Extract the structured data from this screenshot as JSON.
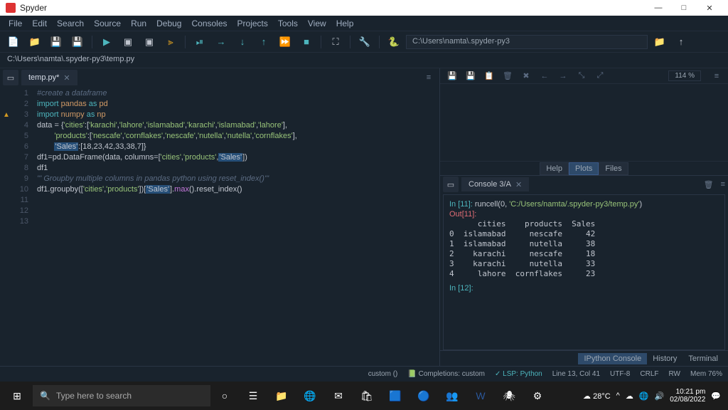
{
  "window": {
    "title": "Spyder",
    "min": "—",
    "max": "□",
    "close": "✕"
  },
  "menu": [
    "File",
    "Edit",
    "Search",
    "Source",
    "Run",
    "Debug",
    "Consoles",
    "Projects",
    "Tools",
    "View",
    "Help"
  ],
  "pathcombo": "C:\\Users\\namta\\.spyder-py3",
  "breadcrumb": "C:\\Users\\namta\\.spyder-py3\\temp.py",
  "editor": {
    "tab": "temp.py*",
    "linecount": 13,
    "lines": [
      {
        "n": 1,
        "html": "<span class='c-com'>#create a dataframe</span>"
      },
      {
        "n": 2,
        "html": "<span class='c-kw'>import</span> <span class='c-mod'>pandas</span> <span class='c-kw'>as</span> <span class='c-mod'>pd</span>"
      },
      {
        "n": 3,
        "html": "<span class='c-kw'>import</span> <span class='c-mod'>numpy</span> <span class='c-kw'>as</span> <span class='c-mod'>np</span>"
      },
      {
        "n": 4,
        "html": ""
      },
      {
        "n": 5,
        "html": "data = {<span class='c-str'>'cities'</span>:[<span class='c-str'>'karachi'</span>,<span class='c-str'>'lahore'</span>,<span class='c-str'>'islamabad'</span>,<span class='c-str'>'karachi'</span>,<span class='c-str'>'islamabad'</span>,<span class='c-str'>'lahore'</span>],"
      },
      {
        "n": 6,
        "html": "        <span class='c-str'>'products'</span>:[<span class='c-str'>'nescafe'</span>,<span class='c-str'>'cornflakes'</span>,<span class='c-str'>'nescafe'</span>,<span class='c-str'>'nutella'</span>,<span class='c-str'>'nutella'</span>,<span class='c-str'>'cornflakes'</span>],"
      },
      {
        "n": 7,
        "html": "        <span class='c-hl'>'Sales'</span>:[18,23,42,33,38,7]}"
      },
      {
        "n": 8,
        "html": ""
      },
      {
        "n": 9,
        "html": "df1=pd.DataFrame(data, columns=[<span class='c-str'>'cities'</span>,<span class='c-str'>'products'</span>,<span class='c-hl'>'Sales'</span>])"
      },
      {
        "n": 10,
        "html": "df1"
      },
      {
        "n": 11,
        "html": "<span class='c-com'>''' Groupby multiple columns in pandas python using reset_index()'''</span>"
      },
      {
        "n": 12,
        "html": ""
      },
      {
        "n": 13,
        "html": "df1.groupby([<span class='c-str'>'cities'</span>,<span class='c-str'>'products'</span>])[<span class='c-hl'>'Sales'</span>].<span class='c-fn'>max</span>().reset_index()"
      }
    ],
    "hlrow": 13
  },
  "plots": {
    "zoom": "114 %",
    "tabs": [
      "Help",
      "Plots",
      "Files"
    ],
    "active": 1
  },
  "console": {
    "tab": "Console 3/A",
    "in_prompt": "In [11]:",
    "in_cmd_pre": "runcell(0, ",
    "in_cmd_str": "'C:/Users/namta/.spyder-py3/temp.py'",
    "in_cmd_post": ")",
    "out_prompt": "Out[11]:",
    "table_hdr": "      cities    products  Sales",
    "table_rows": [
      "0  islamabad     nescafe     42",
      "1  islamabad     nutella     38",
      "2    karachi     nescafe     18",
      "3    karachi     nutella     33",
      "4     lahore  cornflakes     23"
    ],
    "next_prompt": "In [12]:",
    "bottom_tabs": [
      "IPython Console",
      "History",
      "Terminal"
    ],
    "bottom_active": 0
  },
  "status": {
    "custom": "custom ()",
    "completions": "Completions: custom",
    "lsp": "✓ LSP: Python",
    "pos": "Line 13, Col 41",
    "enc": "UTF-8",
    "eol": "CRLF",
    "rw": "RW",
    "mem": "Mem 76%"
  },
  "taskbar": {
    "search_placeholder": "Type here to search",
    "weather": "28°C",
    "time": "10:21 pm",
    "date": "02/08/2022"
  }
}
